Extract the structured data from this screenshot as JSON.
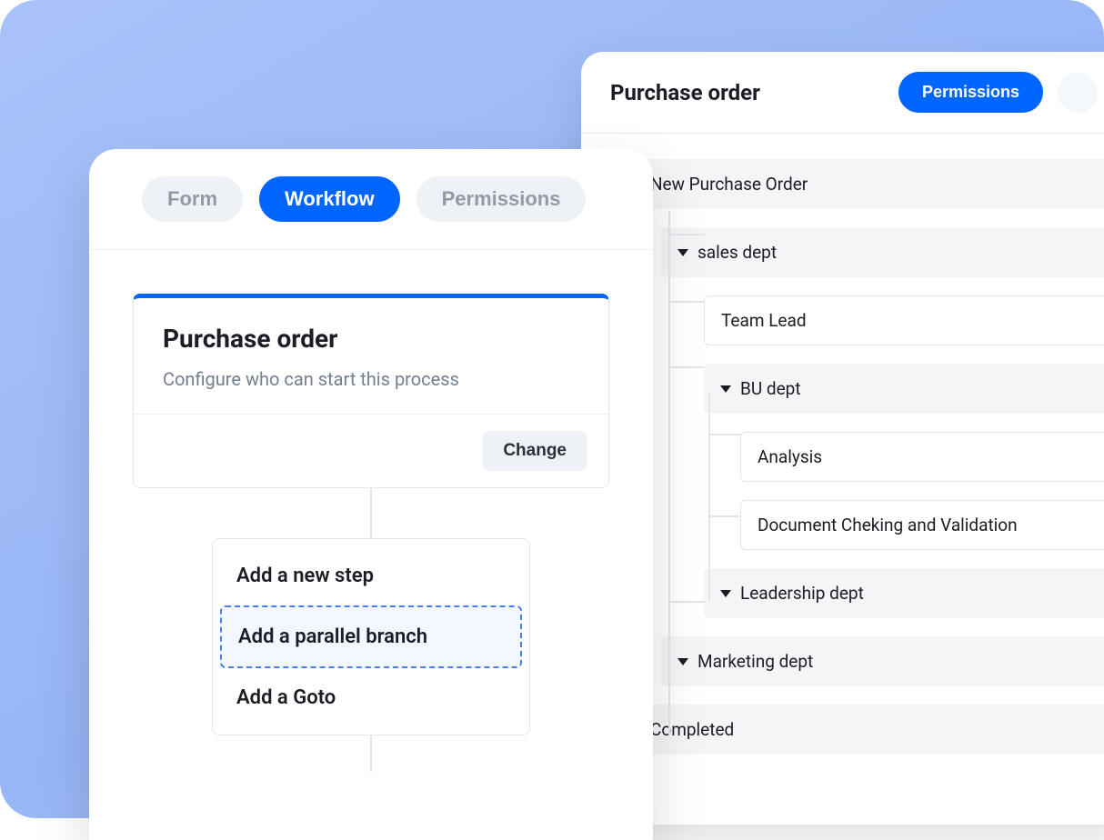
{
  "right_panel": {
    "title": "Purchase order",
    "permissions_button": "Permissions",
    "tree": {
      "root": "New Purchase Order",
      "sales_dept": "sales dept",
      "team_lead": "Team Lead",
      "bu_dept": "BU dept",
      "analysis": "Analysis",
      "doc_check": "Document Cheking and Validation",
      "leadership_dept": "Leadership dept",
      "marketing_dept": "Marketing dept",
      "completed": "Completed"
    }
  },
  "left_panel": {
    "tabs": {
      "form": "Form",
      "workflow": "Workflow",
      "permissions": "Permissions"
    },
    "card": {
      "title": "Purchase order",
      "subtitle": "Configure who can start this process",
      "change": "Change"
    },
    "menu": {
      "add_step": "Add a new step",
      "add_parallel": "Add a parallel branch",
      "add_goto": "Add a Goto"
    }
  }
}
